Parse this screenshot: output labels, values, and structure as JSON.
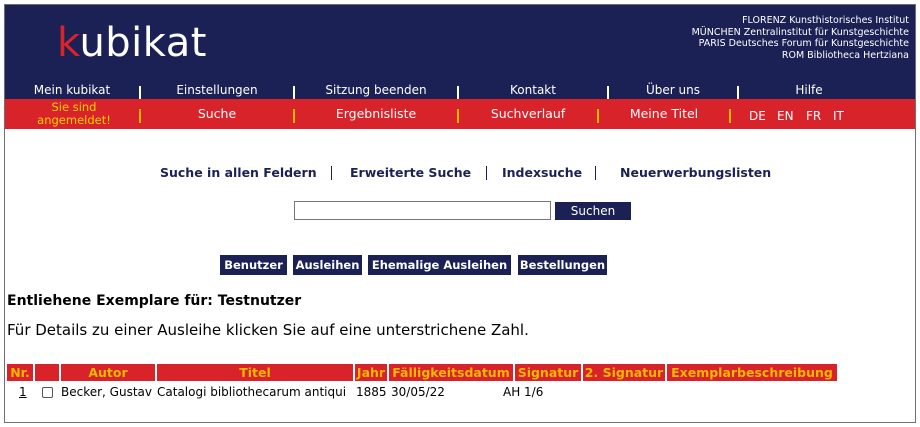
{
  "brand": {
    "logo_first": "k",
    "logo_rest": "ubikat"
  },
  "institutes": [
    "FLORENZ Kunsthistorisches Institut",
    "MÜNCHEN Zentralinstitut für Kunstgeschichte",
    "PARIS Deutsches Forum für Kunstgeschichte",
    "ROM Bibliotheca Hertziana"
  ],
  "top_nav": [
    "Mein kubikat",
    "Einstellungen",
    "Sitzung beenden",
    "Kontakt",
    "Über uns",
    "Hilfe"
  ],
  "sub_nav": {
    "status_line1": "Sie sind",
    "status_line2": "angemeldet!",
    "items": [
      "Suche",
      "Ergebnisliste",
      "Suchverlauf",
      "Meine Titel"
    ],
    "languages": [
      "DE",
      "EN",
      "FR",
      "IT"
    ]
  },
  "search": {
    "links": [
      "Suche in allen Feldern",
      "Erweiterte Suche",
      "Indexsuche",
      "Neuerwerbungslisten"
    ],
    "input_value": "",
    "button": "Suchen"
  },
  "account_tabs": [
    "Benutzer",
    "Ausleihen",
    "Ehemalige Ausleihen",
    "Bestellungen"
  ],
  "section_title": "Entliehene Exemplare für: Testnutzer",
  "info_text": "Für Details zu einer Ausleihe klicken Sie auf eine unterstrichene Zahl.",
  "table": {
    "headers": [
      "Nr.",
      "",
      "Autor",
      "Titel",
      "Jahr",
      "Fälligkeitsdatum",
      "Signatur",
      "2. Signatur",
      "Exemplarbeschreibung"
    ],
    "rows": [
      {
        "nr": "1",
        "checked": false,
        "author": "Becker, Gustav",
        "title": "Catalogi bibliothecarum antiqui",
        "year": "1885",
        "due": "30/05/22",
        "signature": "AH 1/6",
        "signature2": "",
        "description": ""
      }
    ]
  },
  "colors": {
    "navy": "#1b2155",
    "red": "#d8232a",
    "yellow": "#f4b800"
  }
}
